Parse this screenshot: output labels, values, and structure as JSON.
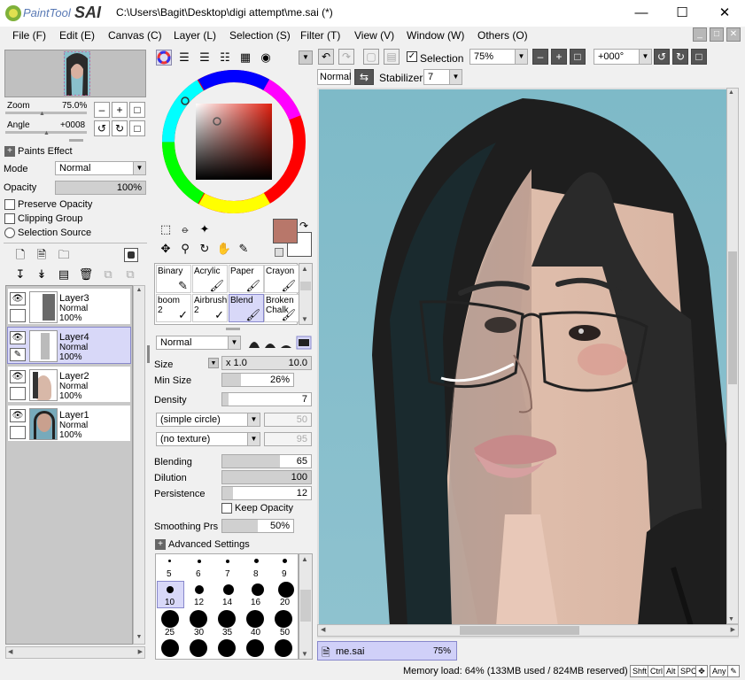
{
  "window": {
    "app_logo_text_1": "PaintTool",
    "app_logo_text_2": "SAI",
    "title": "C:\\Users\\Bagit\\Desktop\\digi attempt\\me.sai (*)"
  },
  "menu": [
    "File (F)",
    "Edit (E)",
    "Canvas (C)",
    "Layer (L)",
    "Selection (S)",
    "Filter (T)",
    "View (V)",
    "Window (W)",
    "Others (O)"
  ],
  "navigator": {
    "zoom_label": "Zoom",
    "zoom_value": "75.0%",
    "angle_label": "Angle",
    "angle_value": "+0008"
  },
  "paints_effect": {
    "title": "Paints Effect",
    "mode_label": "Mode",
    "mode_value": "Normal",
    "opacity_label": "Opacity",
    "opacity_value": "100%",
    "preserve_opacity": "Preserve Opacity",
    "clipping_group": "Clipping Group",
    "selection_source": "Selection Source"
  },
  "layers": [
    {
      "name": "Layer3",
      "mode": "Normal",
      "opacity": "100%"
    },
    {
      "name": "Layer4",
      "mode": "Normal",
      "opacity": "100%"
    },
    {
      "name": "Layer2",
      "mode": "Normal",
      "opacity": "100%"
    },
    {
      "name": "Layer1",
      "mode": "Normal",
      "opacity": "100%"
    }
  ],
  "colors": {
    "primary": "#b8776a",
    "accent_selection": "#d8d8f8"
  },
  "brushes": [
    {
      "name": "Binary",
      "size": ""
    },
    {
      "name": "Acrylic",
      "size": ""
    },
    {
      "name": "Paper",
      "size": ""
    },
    {
      "name": "Crayon",
      "size": ""
    },
    {
      "name": "boom",
      "size": "2"
    },
    {
      "name": "Airbrush",
      "size": "2"
    },
    {
      "name": "Blend",
      "size": ""
    },
    {
      "name": "Broken Chalk",
      "size": ""
    }
  ],
  "brush_settings": {
    "blend_mode": "Normal",
    "size_label": "Size",
    "size_mult": "x 1.0",
    "size_value": "10.0",
    "min_size_label": "Min Size",
    "min_size_value": "26%",
    "density_label": "Density",
    "density_value": "7",
    "shape": "(simple circle)",
    "shape_value": "50",
    "texture": "(no texture)",
    "texture_value": "95",
    "blending_label": "Blending",
    "blending_value": "65",
    "dilution_label": "Dilution",
    "dilution_value": "100",
    "persistence_label": "Persistence",
    "persistence_value": "12",
    "keep_opacity": "Keep Opacity",
    "smoothing_label": "Smoothing Prs",
    "smoothing_value": "50%",
    "advanced": "Advanced Settings"
  },
  "brush_sizes": [
    "5",
    "6",
    "7",
    "8",
    "9",
    "10",
    "12",
    "14",
    "16",
    "20",
    "25",
    "30",
    "35",
    "40",
    "50"
  ],
  "toolbar": {
    "selection_label": "Selection",
    "zoom": "75%",
    "angle": "+000°",
    "mode": "Normal",
    "stabilizer_label": "Stabilizer",
    "stabilizer_value": "7"
  },
  "document_tab": {
    "name": "me.sai",
    "zoom": "75%"
  },
  "status": {
    "memory": "Memory load: 64% (133MB used / 824MB reserved)",
    "keys": [
      "Shft",
      "Ctrl",
      "Alt",
      "SPC",
      "Any"
    ]
  }
}
